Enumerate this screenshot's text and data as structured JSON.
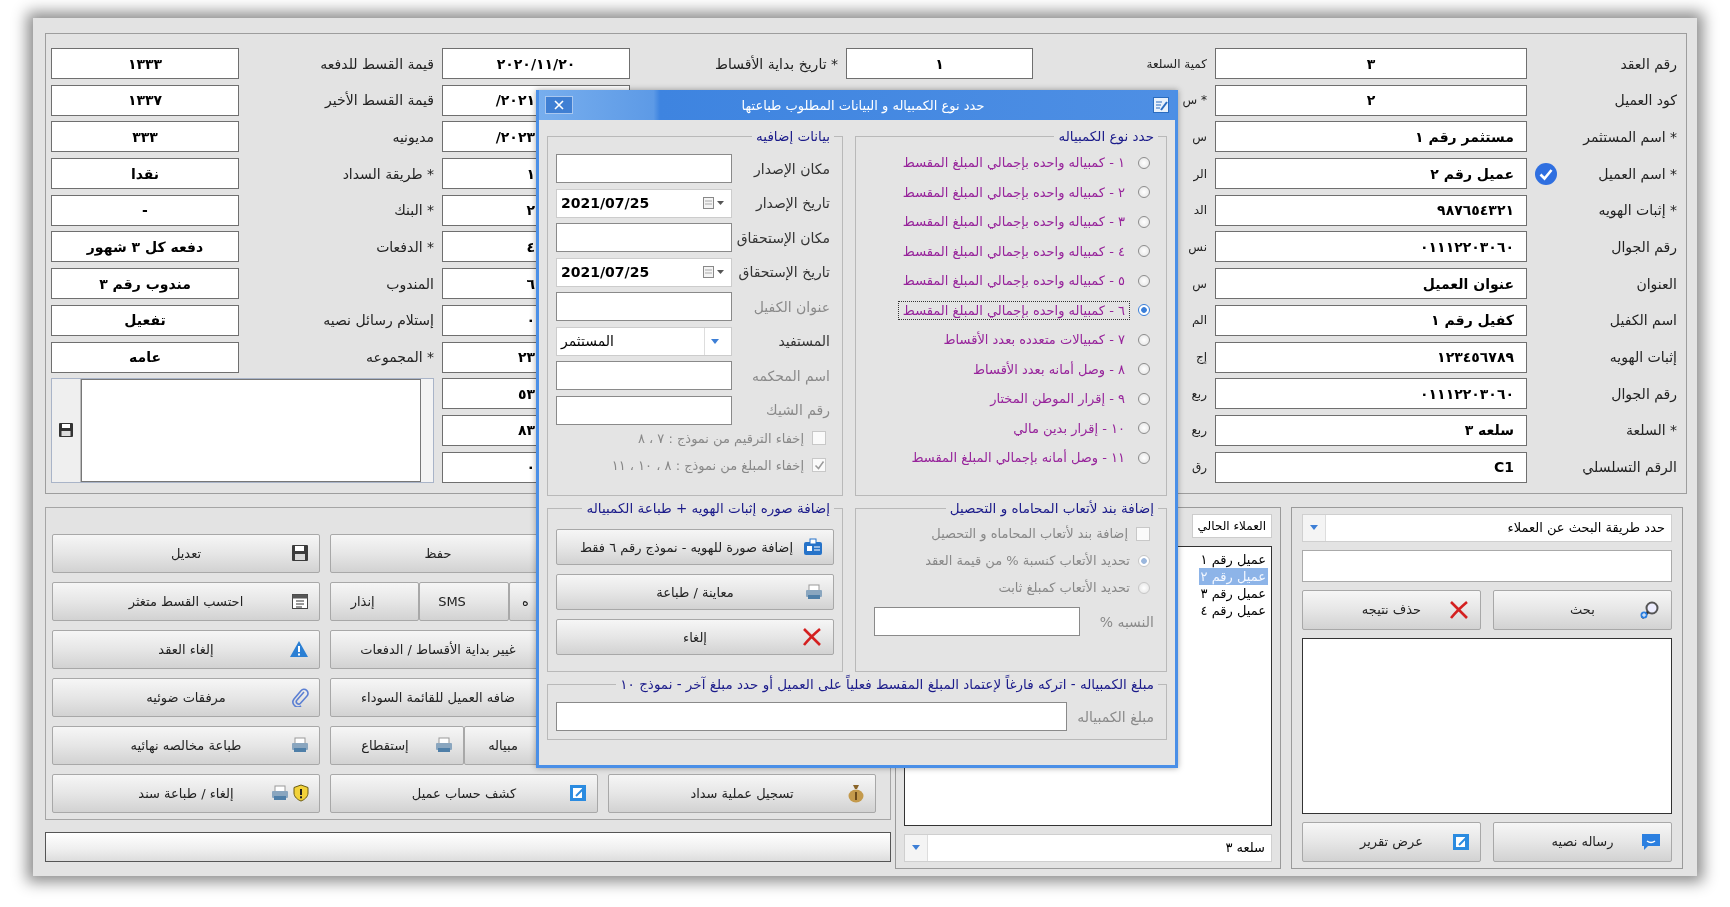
{
  "customer_fields": [
    {
      "label": "رقم العقد",
      "value": "٣",
      "verified": false
    },
    {
      "label": "كود العميل",
      "value": "٢",
      "verified": false
    },
    {
      "label": "* اسم المستثمر",
      "value": "مستثمر رقم ١",
      "verified": false
    },
    {
      "label": "* اسم العميل",
      "value": "عميل رقم ٢",
      "verified": true
    },
    {
      "label": "* إثبات الهويه",
      "value": "٩٨٧٦٥٤٣٢١",
      "verified": false
    },
    {
      "label": "رقم الجوال",
      "value": "٠١١١٢٢٠٣٠٦٠",
      "verified": false
    },
    {
      "label": "العنوان",
      "value": "عنوان العميل",
      "verified": false
    },
    {
      "label": "اسم الكفيل",
      "value": "كفيل رقم ١",
      "verified": false
    },
    {
      "label": "إثبات الهويه",
      "value": "١٢٣٤٥٦٧٨٩",
      "verified": false
    },
    {
      "label": "رقم الجوال",
      "value": "٠١١١٢٢٠٣٠٦٠",
      "verified": false
    },
    {
      "label": "* السلعة",
      "value": "سلعه ٣",
      "verified": false
    },
    {
      "label": "الرقم التسلسلي",
      "value": "C1",
      "verified": false
    }
  ],
  "sale_fields": [
    {
      "label": "كمية السلعة",
      "value": "١"
    },
    {
      "label": "* س"
    },
    {
      "label": "س"
    },
    {
      "label": "الر"
    },
    {
      "label": "الد"
    },
    {
      "label": "نس"
    },
    {
      "label": "س"
    },
    {
      "label": "الم"
    },
    {
      "label": "إج"
    },
    {
      "label": "ربع"
    },
    {
      "label": "ربع"
    },
    {
      "label": "رق"
    }
  ],
  "schedule_fields": [
    {
      "label": "* تاريخ بداية الأقساط",
      "value": "٢٠٢٠/١١/٢٠"
    },
    {
      "value": "٢٠٢١/"
    },
    {
      "value": "٢٠٢٣/"
    },
    {
      "value": "١"
    },
    {
      "value": "٢"
    },
    {
      "value": "٤"
    },
    {
      "value": "٦"
    },
    {
      "value": "٠"
    },
    {
      "value": "٢٣"
    },
    {
      "value": "٥٣"
    },
    {
      "value": "٨٣"
    },
    {
      "value": "٠"
    }
  ],
  "payment_fields": [
    {
      "label": "قيمة القسط للدفعه",
      "value": "١٣٣٣"
    },
    {
      "label": "قيمة القسط الأخير",
      "value": "١٣٣٧"
    },
    {
      "label": "مديونيه",
      "value": "٣٣٣"
    },
    {
      "label": "* طريقة السداد",
      "value": "نقدا"
    },
    {
      "label": "* البنك",
      "value": "-"
    },
    {
      "label": "* الدفعات",
      "value": "دفعه كل ٣ شهور"
    },
    {
      "label": "المندوب",
      "value": "مندوب رقم ٣"
    },
    {
      "label": "إستلام رسائل نصيه",
      "value": "تفعيل"
    },
    {
      "label": "* المجموعه",
      "value": "عامه"
    }
  ],
  "actions": [
    [
      {
        "kind": "button",
        "label": "حفظ"
      },
      {
        "kind": "button",
        "label": "تعديل"
      }
    ],
    [
      {
        "kind": "split",
        "parts": [
          "ه",
          "SMS",
          "إنذار"
        ]
      },
      {
        "kind": "button",
        "label": "احتسب القسط متغثر"
      }
    ],
    [
      {
        "kind": "button",
        "label": "غيير بداية الأقساط / الدفعات"
      },
      {
        "kind": "button",
        "label": "إلغاء العقد"
      }
    ],
    [
      {
        "kind": "button",
        "label": "ضافه العميل للقائمة السوداء"
      },
      {
        "kind": "button",
        "label": "مرفقات ضوئيه"
      }
    ],
    [
      {
        "kind": "split",
        "parts": [
          "مبياله",
          "إستقطاع"
        ]
      },
      {
        "kind": "button",
        "label": "طباعة مخالصه نهائيه"
      }
    ],
    [
      {
        "kind": "button",
        "label": "تسجيل عملية سداد"
      },
      {
        "kind": "button",
        "label": "كشف حساب عميل"
      },
      {
        "kind": "button",
        "label": "إلغاء / طباعة سند"
      }
    ]
  ],
  "customer_list": {
    "header": "العملاء الحالي",
    "items": [
      {
        "label": "عميل رقم ١",
        "selected": false
      },
      {
        "label": "عميل رقم ٢",
        "selected": true
      },
      {
        "label": "عميل رقم ٣",
        "selected": false
      },
      {
        "label": "عميل رقم ٤",
        "selected": false
      }
    ],
    "product_combo": "سلعه ٣"
  },
  "search_panel": {
    "method_combo": "حدد طريقة البحث عن العملاء",
    "search_button": "بحث",
    "clear_button": "حذف نتيجه",
    "sms_button": "رساله نصيه",
    "report_button": "عرض تقرير"
  },
  "dialog": {
    "title": "حدد نوع الكمبياله و البيانات المطلوب طباعتها",
    "type_group": {
      "legend": "حدد نوع الكمبياله",
      "options": [
        {
          "label": "١ - كمبياله واحده بإجمالي المبلغ المقسط",
          "selected": false
        },
        {
          "label": "٢ - كمبياله واحده بإجمالي المبلغ المقسط",
          "selected": false
        },
        {
          "label": "٣ - كمبياله واحده بإجمالي المبلغ المقسط",
          "selected": false
        },
        {
          "label": "٤ - كمبياله واحده بإجمالي المبلغ المقسط",
          "selected": false
        },
        {
          "label": "٥ - كمبياله واحده بإجمالي المبلغ المقسط",
          "selected": false
        },
        {
          "label": "٦ - كمبياله واحده بإجمالي المبلغ المقسط",
          "selected": true
        },
        {
          "label": "٧ - كمبيالات متعدده بعدد الأقساط",
          "selected": false
        },
        {
          "label": "٨ - وصل أمانه بعدد الأقساط",
          "selected": false
        },
        {
          "label": "٩ - إقرار الموطن المختار",
          "selected": false
        },
        {
          "label": "١٠ - إقرار بدين مالي",
          "selected": false
        },
        {
          "label": "١١ - وصل أمانه بإجمالي المبلغ المقسط",
          "selected": false
        }
      ]
    },
    "extra_group": {
      "legend": "بيانات إضافيه",
      "fields": [
        {
          "kind": "text",
          "label": "مكان الإصدار",
          "disabled": false
        },
        {
          "kind": "date",
          "label": "تاريخ الإصدار",
          "value": "2021/07/25",
          "disabled": false
        },
        {
          "kind": "text",
          "label": "مكان الإستحقاق",
          "disabled": false
        },
        {
          "kind": "date",
          "label": "تاريخ الإستحقاق",
          "value": "2021/07/25",
          "disabled": false
        },
        {
          "kind": "text",
          "label": "عنوان الكفيل",
          "disabled": true
        },
        {
          "kind": "combo",
          "label": "المستفيد",
          "value": "المستثمر",
          "disabled": false
        },
        {
          "kind": "text",
          "label": "اسم المحكمه",
          "disabled": true
        },
        {
          "kind": "text",
          "label": "رقم الشيك",
          "disabled": true
        }
      ],
      "checkboxes": [
        {
          "label": "إخفاء الترقيم من نموذج : ٧ ، ٨",
          "checked": false,
          "disabled": true
        },
        {
          "label": "إخفاء المبلغ من نموذج : ٨ ، ١٠ ، ١١",
          "checked": true,
          "disabled": true
        }
      ]
    },
    "fees_group": {
      "legend": "إضافة بند لأتعاب المحاماه و التحصيل",
      "checkbox": {
        "label": "إضافة بند لأتعاب المحاماه و التحصيل",
        "checked": false,
        "disabled": true
      },
      "options": [
        {
          "label": "تحديد الأتعاب كنسبة % من قيمة العقد",
          "selected": true,
          "disabled": true
        },
        {
          "label": "تحديد الأتعاب كمبلغ ثابت",
          "selected": false,
          "disabled": true
        }
      ],
      "percent_field": {
        "label": "النسبه %",
        "disabled": true
      }
    },
    "id_group": {
      "legend": "إضافة صوره إثبات الهويه + طباعة الكمبياله",
      "buttons": [
        "إضافة صورة للهويه - نموذج رقم ٦ فقط",
        "معاينة / طباعة",
        "إلغاء"
      ]
    },
    "amount_group": {
      "legend": "مبلغ الكمبياله - اتركه فارغاً لإعتماد المبلغ المقسط فعلياً على العميل أو حدد مبلغ آخر - نموذج ١٠",
      "field": {
        "label": "مبلغ الكمبياله",
        "disabled": true
      }
    }
  }
}
